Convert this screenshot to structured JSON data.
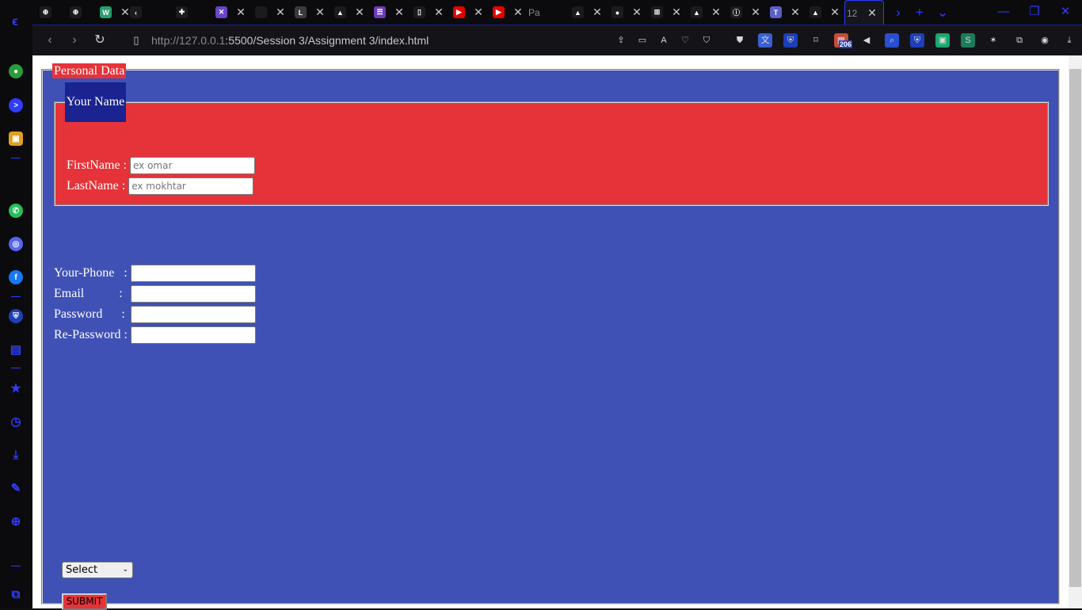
{
  "browser": {
    "tabs": [
      {
        "icon": "globe-icon",
        "glyph": "⊕",
        "color": "#1b1b1f"
      },
      {
        "icon": "globe-icon",
        "glyph": "⊕",
        "color": "#1b1b1f"
      },
      {
        "icon": "wikimedia-icon",
        "glyph": "W",
        "color": "#2a9d6d"
      },
      {
        "icon": "chevron-left-icon",
        "glyph": "‹",
        "color": "#1b1b1f"
      },
      {
        "icon": "ai-icon",
        "glyph": "✚",
        "color": "#1b1b1f"
      },
      {
        "icon": "tool-icon",
        "glyph": "✕",
        "color": "#6a44c8"
      },
      {
        "icon": "blank-icon",
        "glyph": "",
        "color": "#1b1b1f"
      },
      {
        "icon": "letter-l-icon",
        "glyph": "L",
        "color": "#3a3a3a"
      },
      {
        "icon": "google-drive-icon",
        "glyph": "▲",
        "color": "#1b1b1f"
      },
      {
        "icon": "list-icon",
        "glyph": "☰",
        "color": "#6a3cb8"
      },
      {
        "icon": "document-icon",
        "glyph": "▯",
        "color": "#1b1b1f"
      },
      {
        "icon": "youtube-icon",
        "glyph": "▶",
        "color": "#e60000"
      },
      {
        "icon": "youtube-icon",
        "glyph": "▶",
        "color": "#e60000"
      },
      {
        "icon": "page-text-icon",
        "glyph": "Pa",
        "color": "#0b0b0d"
      },
      {
        "icon": "google-drive-icon",
        "glyph": "▲",
        "color": "#1b1b1f"
      },
      {
        "icon": "github-icon",
        "glyph": "●",
        "color": "#1b1b1f"
      },
      {
        "icon": "microsoft-icon",
        "glyph": "⊞",
        "color": "#1b1b1f"
      },
      {
        "icon": "google-drive-icon",
        "glyph": "▲",
        "color": "#1b1b1f"
      },
      {
        "icon": "info-icon",
        "glyph": "ⓘ",
        "color": "#1b1b1f"
      },
      {
        "icon": "teams-icon",
        "glyph": "T",
        "color": "#5b5fc7"
      },
      {
        "icon": "google-drive-icon",
        "glyph": "▲",
        "color": "#1b1b1f"
      },
      {
        "icon": "localhost-tab-icon",
        "glyph": "12",
        "color": "#16161d"
      }
    ],
    "close_glyph": "✕",
    "tab_controls": {
      "scroll": "›",
      "new_tab": "+",
      "list": "⌄"
    },
    "window_controls": {
      "minimize": "—",
      "restore": "❐",
      "close": "✕"
    },
    "url_host": "http://127.0.0.1",
    "url_path": ":5500/Session 3/Assignment 3/index.html",
    "extension_badge": "206",
    "extensions": [
      "share-icon",
      "screen-capture-icon",
      "translate-icon",
      "heart-icon",
      "shield-icon",
      "shield-check-icon",
      "language-icon",
      "bitwarden-icon",
      "mouse-icon",
      "calendar-badge-icon",
      "volume-icon",
      "search-extension-icon",
      "bitwarden-icon",
      "save-icon",
      "stylus-icon",
      "image-icon",
      "extensions-icon",
      "profile-icon",
      "download-icon"
    ],
    "sidebar": [
      "contacts-icon",
      "terminal-icon",
      "chat-app-icon",
      "whatsapp-icon",
      "discord-icon",
      "facebook-icon",
      "bitwarden-icon",
      "briefcase-icon",
      "star-icon",
      "history-icon",
      "download-icon",
      "pen-icon",
      "globe-icon",
      "extensions-icon"
    ]
  },
  "form": {
    "outer_legend": "Personal Data",
    "inner_legend": "Your Name",
    "first_name_label": "FirstName : ",
    "first_name_placeholder": "ex omar",
    "last_name_label": "LastName : ",
    "last_name_placeholder": "ex mokhtar",
    "phone_label": "Your-Phone   : ",
    "email_label": "Email           : ",
    "password_label": "Password      : ",
    "repassword_label": "Re-Password : ",
    "select_value": "Select",
    "submit_label": "SUBMIT"
  },
  "colors": {
    "fieldset_bg": "#3f51b5",
    "name_fieldset_bg": "#e53339",
    "name_legend_bg": "#1a2390",
    "accent": "#2f3cff"
  }
}
